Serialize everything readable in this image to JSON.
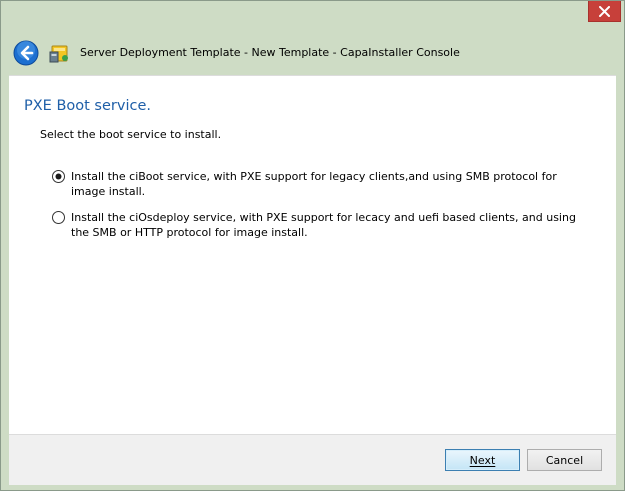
{
  "window": {
    "title": "Server Deployment Template - New Template - CapaInstaller Console"
  },
  "page": {
    "heading": "PXE Boot service.",
    "instruction": "Select the boot service to install."
  },
  "options": [
    {
      "label": "Install the ciBoot service, with PXE support for legacy clients,and using SMB protocol for image install.",
      "selected": true
    },
    {
      "label": "Install the ciOsdeploy service, with PXE support for lecacy and uefi based clients, and using the SMB or HTTP protocol for image install.",
      "selected": false
    }
  ],
  "buttons": {
    "next": "Next",
    "cancel": "Cancel"
  },
  "icons": {
    "back": "back-arrow-icon",
    "app": "capainstaller-app-icon",
    "close": "close-icon"
  },
  "colors": {
    "chrome": "#cedcc5",
    "heading": "#1f5fa8",
    "close": "#c7403a",
    "default_button_border": "#3c7fb1"
  }
}
